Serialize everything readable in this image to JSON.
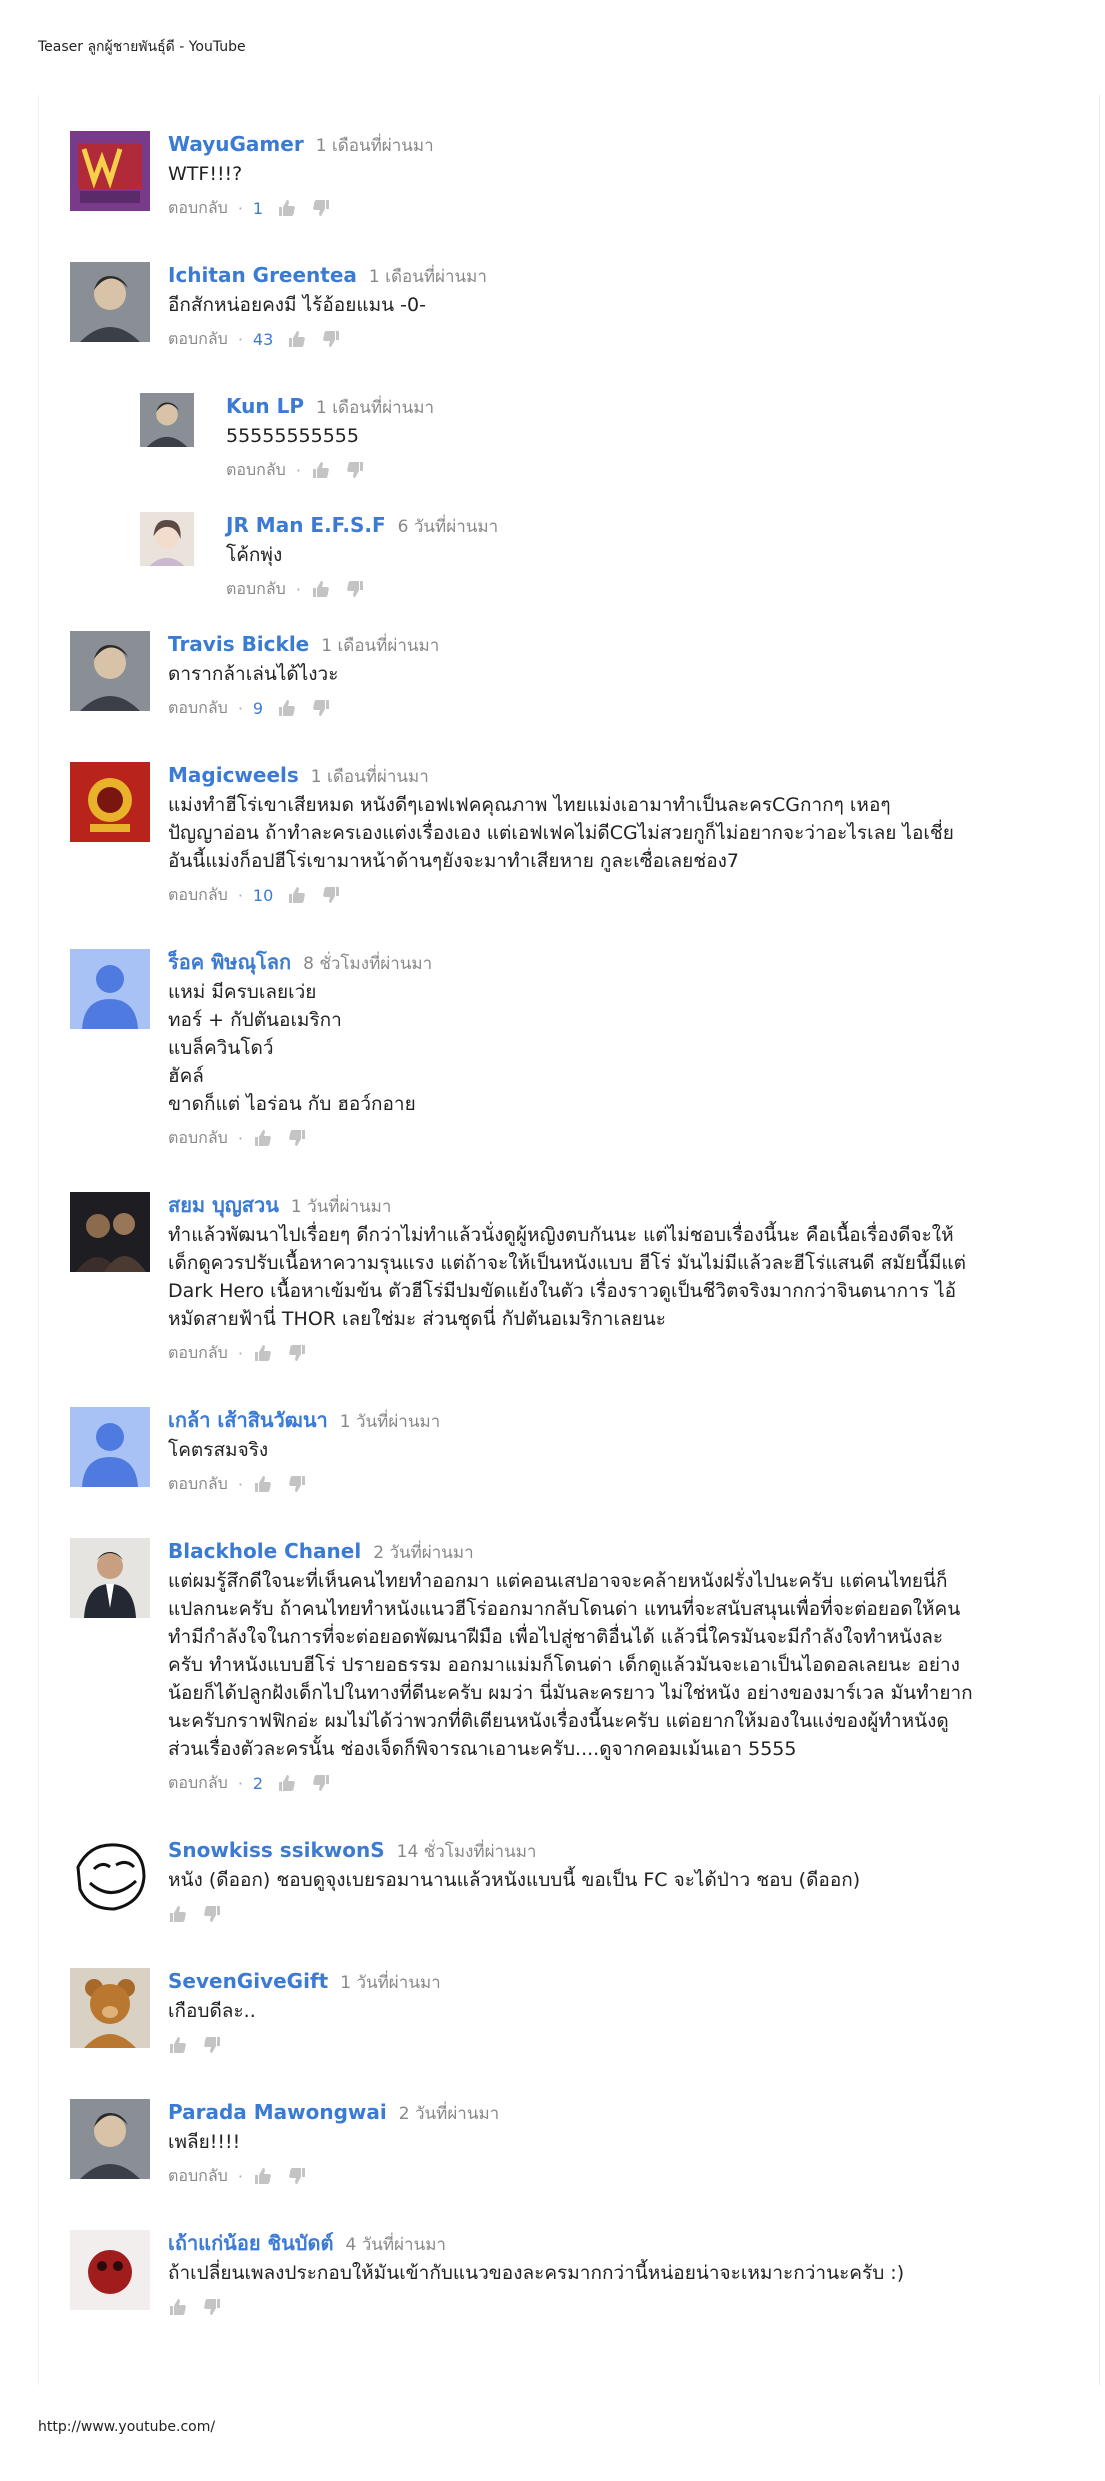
{
  "page": {
    "title": "Teaser ลูกผู้ชายพันธุ์ดี - YouTube",
    "footer_url": "http://www.youtube.com/"
  },
  "labels": {
    "reply": "ตอบกลับ",
    "dot": "·"
  },
  "colors": {
    "author": "#3b7bd4",
    "time": "#888888",
    "likes": "#3b7bd4"
  },
  "comments": [
    {
      "author": "WayuGamer",
      "time": "1 เดือนที่ผ่านมา",
      "text": "WTF!!!?",
      "likes": "1",
      "avatar": "wayugamer-logo"
    },
    {
      "author": "Ichitan Greentea",
      "time": "1 เดือนที่ผ่านมา",
      "text": "อีกสักหน่อยคงมี ไร้อ้อยแมน -0-",
      "likes": "43",
      "avatar": "user-photo"
    },
    {
      "author": "Kun LP",
      "time": "1 เดือนที่ผ่านมา",
      "text": "55555555555",
      "likes": "",
      "avatar": "user-photo",
      "reply": true
    },
    {
      "author": "JR Man E.F.S.F",
      "time": "6 วันที่ผ่านมา",
      "text": "โค้กพุ่ง",
      "likes": "",
      "avatar": "anime-photo",
      "reply": true
    },
    {
      "author": "Travis Bickle",
      "time": "1 เดือนที่ผ่านมา",
      "text": "ดารากล้าเล่นได้ไงวะ",
      "likes": "9",
      "avatar": "user-photo"
    },
    {
      "author": "Magicweels",
      "time": "1 เดือนที่ผ่านมา",
      "text": "แม่งทำฮีโร่เขาเสียหมด หนังดีๆเอฟเฟคคุณภาพ ไทยแม่งเอามาทำเป็นละครCGกากๆ เหอๆ\nปัญญาอ่อน ถ้าทำละครเองแต่งเรื่องเอง แต่เอฟเฟคไม่ดีCGไม่สวยกูก็ไม่อยากจะว่าอะไรเลย ไอเชี่ย\nอันนี้แม่งก็อปฮีโร่เขามาหน้าด้านๆยังจะมาทำเสียหาย กูละเซื่อเลยช่อง7",
      "likes": "10",
      "avatar": "emblem-logo"
    },
    {
      "author": "ร็อค พิษณุโลก",
      "time": "8 ชั่วโมงที่ผ่านมา",
      "text": "แหม่ มีครบเลยเว่ย\nทอร์ + กัปตันอเมริกา\nแบล็ควินโดว์\nฮัคล์\nขาดก็แต่ ไอร่อน กับ ฮอว์กอาย",
      "likes": "",
      "avatar": "default-avatar"
    },
    {
      "author": "สยม บุญสวน",
      "time": "1 วันที่ผ่านมา",
      "text": "ทำแล้วพัฒนาไปเรื่อยๆ ดีกว่าไม่ทำแล้วนั่งดูผู้หญิงตบกันนะ แต่ไม่ชอบเรื่องนี้นะ คือเนื้อเรื่องดีจะให้\nเด็กดูควรปรับเนื้อหาความรุนแรง แต่ถ้าจะให้เป็นหนังแบบ ฮีโร่ มันไม่มีแล้วละฮีโร่แสนดี สมัยนี้มีแต่\nDark Hero เนื้อหาเข้มข้น ตัวฮีโร่มีปมขัดแย้งในตัว เรื่องราวดูเป็นชีวิตจริงมากกว่าจินตนาการ ไอ้\nหมัดสายฟ้านี่ THOR เลยใช่มะ ส่วนชุดนี่ กัปตันอเมริกาเลยนะ",
      "likes": "",
      "avatar": "movie-photo"
    },
    {
      "author": "เกล้า เส้าสินวัฒนา",
      "time": "1 วันที่ผ่านมา",
      "text": "โคตรสมจริง",
      "likes": "",
      "avatar": "default-avatar"
    },
    {
      "author": "Blackhole Chanel",
      "time": "2 วันที่ผ่านมา",
      "text": "แต่ผมรู้สึกดีใจนะที่เห็นคนไทยทำออกมา แต่คอนเสปอาจจะคล้ายหนังฝรั่งไปนะครับ แต่คนไทยนี่ก็\nแปลกนะครับ ถ้าคนไทยทำหนังแนวฮีโร่ออกมากลับโดนด่า แทนที่จะสนับสนุนเพื่อที่จะต่อยอดให้คน\nทำมีกำลังใจในการที่จะต่อยอดพัฒนาฝีมือ เพื่อไปสู่ชาติอื่นได้ แล้วนี่ใครมันจะมีกำลังใจทำหนังละ\nครับ ทำหนังแบบฮีโร่ ปรายอธรรม ออกมาแม่มก็โดนด่า เด็กดูแล้วมันจะเอาเป็นไอดอลเลยนะ อย่าง\nน้อยก็ได้ปลูกฝังเด็กไปในทางที่ดีนะครับ ผมว่า นี่มันละครยาว ไม่ใช่หนัง อย่างของมาร์เวล มันทำยาก\nนะครับกราฟฟิกอ่ะ ผมไม่ได้ว่าพวกที่ติเตียนหนังเรื่องนี้นะครับ แต่อยากให้มองในแง่ของผู้ทำหนังดู\nส่วนเรื่องตัวละครนั้น ช่องเจ็ดก็พิจารณาเอานะครับ....ดูจากคอมเม้นเอา 5555",
      "likes": "2",
      "avatar": "suit-photo"
    },
    {
      "author": "Snowkiss ssikwonS",
      "time": "14 ชั่วโมงที่ผ่านมา",
      "text": "หนัง (ดีออก)  ชอบดูจุงเบยรอมานานแล้วหนังแบบนี้ ขอเป็น FC จะได้ป่าว ชอบ (ดีออก)",
      "likes": "",
      "avatar": "troll-face",
      "no_reply": true
    },
    {
      "author": "SevenGiveGift",
      "time": "1 วันที่ผ่านมา",
      "text": "เกือบดีละ..",
      "likes": "",
      "avatar": "teddy-bear",
      "no_reply": true
    },
    {
      "author": "Parada Mawongwai",
      "time": "2 วันที่ผ่านมา",
      "text": "เพลีย!!!!",
      "likes": "",
      "avatar": "user-photo"
    },
    {
      "author": "เถ้าแก่น้อย ชินบัดต์",
      "time": "4 วันที่ผ่านมา",
      "text": "ถ้าเปลี่ยนเพลงประกอบให้มันเข้ากับแนวของละครมากกว่านี้หน่อยน่าจะเหมาะกว่านะครับ :)",
      "likes": "",
      "avatar": "red-photo",
      "no_reply": true
    }
  ]
}
